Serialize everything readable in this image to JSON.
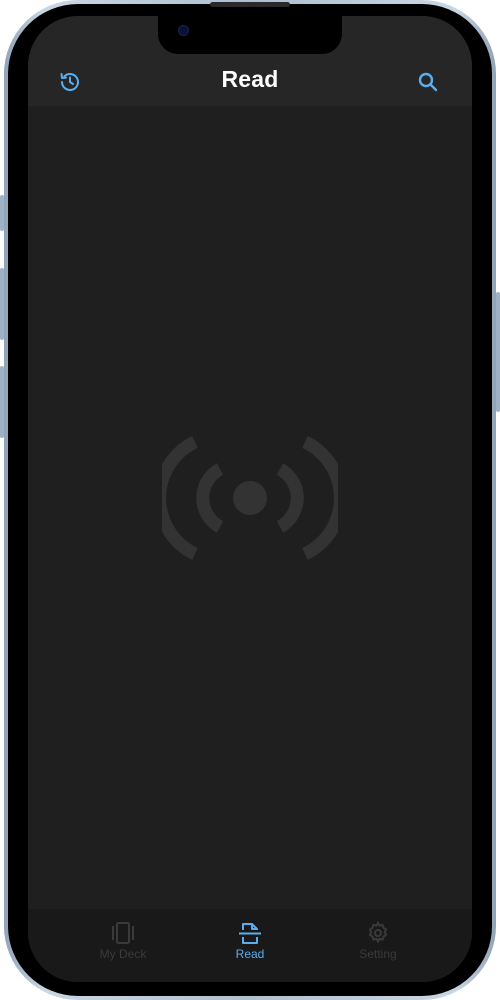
{
  "header": {
    "title": "Read",
    "left_icon": "history-icon",
    "right_icon": "search-icon"
  },
  "main": {
    "center_icon": "nfc-wireless-icon"
  },
  "tab_bar": {
    "tabs": [
      {
        "label": "My Deck",
        "icon": "cards-icon",
        "active": false
      },
      {
        "label": "Read",
        "icon": "scan-document-icon",
        "active": true
      },
      {
        "label": "Setting",
        "icon": "gear-icon",
        "active": false
      }
    ]
  },
  "colors": {
    "accent": "#5aaef0",
    "screen_bg": "#1f1f1f",
    "nav_bg": "#262626",
    "tab_bg": "#191919",
    "inactive": "#3a3a3a",
    "nfc_icon": "#333333"
  }
}
